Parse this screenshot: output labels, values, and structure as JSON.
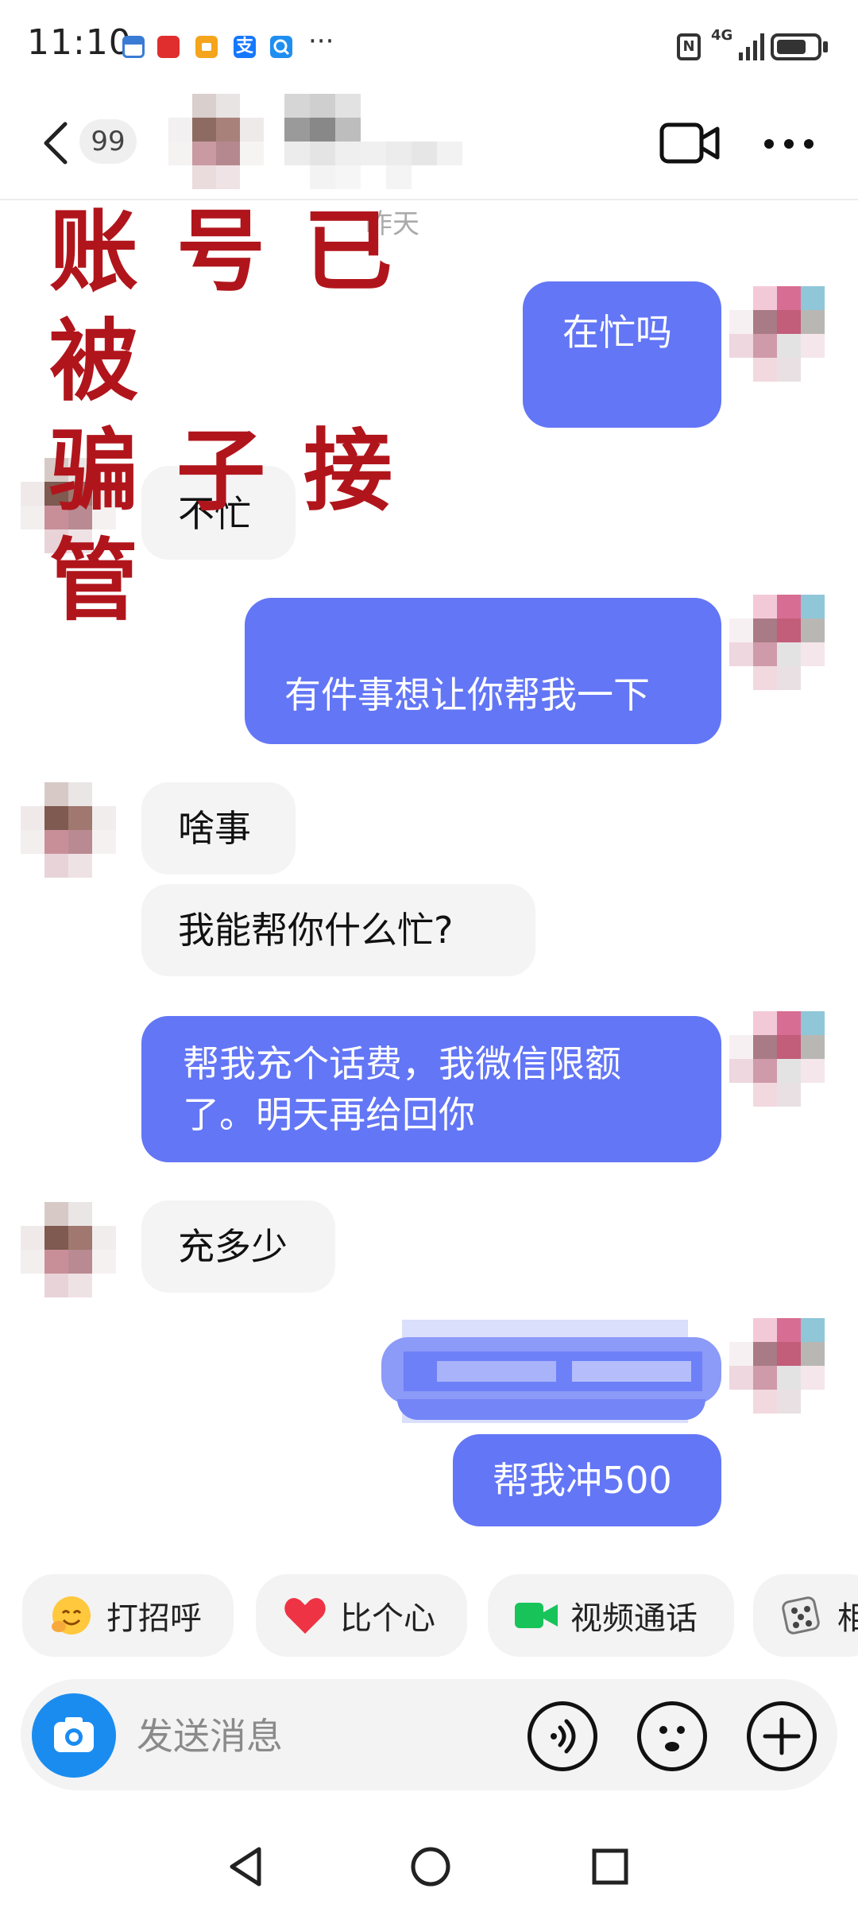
{
  "status_bar": {
    "time": "11:10",
    "app_icons": [
      "calendar-icon",
      "pinduoduo-icon",
      "notes-icon",
      "alipay-icon",
      "search-app-icon"
    ],
    "overflow": "···",
    "network": "4G",
    "battery_level": 0.75
  },
  "header": {
    "unread_count": "99",
    "contact_name": "",
    "icons": [
      "back-arrow-icon",
      "video-call-icon",
      "more-icon"
    ]
  },
  "overlay": {
    "line1": "账号已被",
    "line2": "骗子接管",
    "ghost_text": "昨天"
  },
  "messages": [
    {
      "side": "out",
      "text": "在忙吗"
    },
    {
      "side": "in",
      "text": "不忙"
    },
    {
      "side": "out",
      "text": "有件事想让你帮我一下"
    },
    {
      "side": "in",
      "text": "啥事"
    },
    {
      "side": "in",
      "text": "我能帮你什么忙?"
    },
    {
      "side": "out",
      "text": "帮我充个话费，我微信限额了。明天再给回你"
    },
    {
      "side": "in",
      "text": "充多少"
    },
    {
      "side": "out",
      "text": ""
    },
    {
      "side": "out",
      "text": "帮我冲500"
    }
  ],
  "quick_actions": [
    {
      "label": "打招呼",
      "icon": "wave-face-icon"
    },
    {
      "label": "比个心",
      "icon": "heart-icon"
    },
    {
      "label": "视频通话",
      "icon": "video-camera-icon"
    },
    {
      "label": "相",
      "icon": "dice-icon"
    }
  ],
  "input": {
    "placeholder": "发送消息",
    "buttons": [
      "camera-icon",
      "voice-icon",
      "emoji-icon",
      "plus-icon"
    ]
  },
  "nav": {
    "buttons": [
      "back-nav-icon",
      "home-nav-icon",
      "recents-nav-icon"
    ]
  },
  "colors": {
    "outgoing_bubble": "#6376f6",
    "incoming_bubble": "#f4f4f5",
    "overlay_text": "#b1151c",
    "camera_button": "#1a8cf0"
  }
}
